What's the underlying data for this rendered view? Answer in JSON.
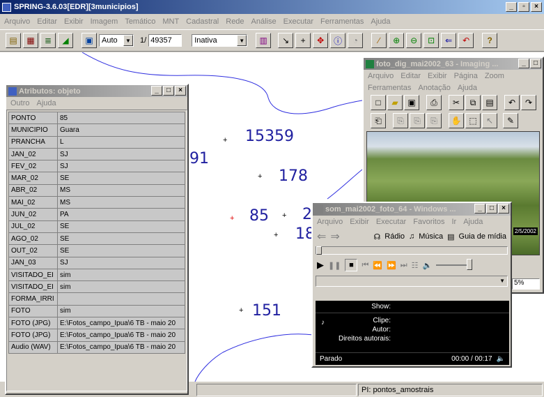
{
  "main_window": {
    "title": "SPRING-3.6.03[EDR][3municipios]",
    "menu": [
      "Arquivo",
      "Editar",
      "Exibir",
      "Imagem",
      "Temático",
      "MNT",
      "Cadastral",
      "Rede",
      "Análise",
      "Executar",
      "Ferramentas",
      "Ajuda"
    ],
    "toolbar": {
      "zoom_mode": "Auto",
      "scale_prefix": "1/",
      "scale_value": "49357",
      "cursor_mode": "Inativa"
    },
    "status_bar": "PI: pontos_amostrais"
  },
  "map_labels": [
    {
      "text": "15359"
    },
    {
      "text": "91"
    },
    {
      "text": "178"
    },
    {
      "text": "85"
    },
    {
      "text": "2"
    },
    {
      "text": "18"
    },
    {
      "text": "151"
    }
  ],
  "attributes_window": {
    "title": "Atributos: objeto",
    "menu": [
      "Outro",
      "Ajuda"
    ],
    "rows": [
      {
        "key": "PONTO",
        "value": "85"
      },
      {
        "key": "MUNICIPIO",
        "value": "Guara"
      },
      {
        "key": "PRANCHA",
        "value": "L"
      },
      {
        "key": "JAN_02",
        "value": "SJ"
      },
      {
        "key": "FEV_02",
        "value": "SJ"
      },
      {
        "key": "MAR_02",
        "value": "SE"
      },
      {
        "key": "ABR_02",
        "value": "MS"
      },
      {
        "key": "MAI_02",
        "value": "MS"
      },
      {
        "key": "JUN_02",
        "value": "PA"
      },
      {
        "key": "JUL_02",
        "value": "SE"
      },
      {
        "key": "AGO_02",
        "value": "SE"
      },
      {
        "key": "OUT_02",
        "value": "SE"
      },
      {
        "key": "JAN_03",
        "value": "SJ"
      },
      {
        "key": "VISITADO_EI",
        "value": "sim"
      },
      {
        "key": "VISITADO_EI",
        "value": "sim"
      },
      {
        "key": "FORMA_IRRI",
        "value": ""
      },
      {
        "key": "FOTO",
        "value": "sim"
      },
      {
        "key": "FOTO (JPG)",
        "value": "E:\\Fotos_campo_Ipua\\6 TB - maio 20"
      },
      {
        "key": "FOTO (JPG)",
        "value": "E:\\Fotos_campo_Ipua\\6 TB - maio 20"
      },
      {
        "key": "Audio (WAV)",
        "value": "E:\\Fotos_campo_Ipua\\6 TB - maio 20"
      }
    ]
  },
  "imaging_window": {
    "title": "foto_dig_mai2002_63 - Imaging ...",
    "menu_row1": [
      "Arquivo",
      "Editar",
      "Exibir",
      "Página",
      "Zoom"
    ],
    "menu_row2": [
      "Ferramentas",
      "Anotação",
      "Ajuda"
    ],
    "photo_date": "2/5/2002",
    "zoom": "5%"
  },
  "media_window": {
    "title": "som_mai2002_foto_64 - Windows ...",
    "menu": [
      "Arquivo",
      "Exibir",
      "Executar",
      "Favoritos",
      "Ir",
      "Ajuda"
    ],
    "links": [
      "Rádio",
      "Música",
      "Guia de mídia"
    ],
    "info": {
      "show_label": "Show:",
      "clip_label": "Clipe:",
      "author_label": "Autor:",
      "rights_label": "Direitos autorais:"
    },
    "status": "Parado",
    "time": "00:00 / 00:17"
  }
}
